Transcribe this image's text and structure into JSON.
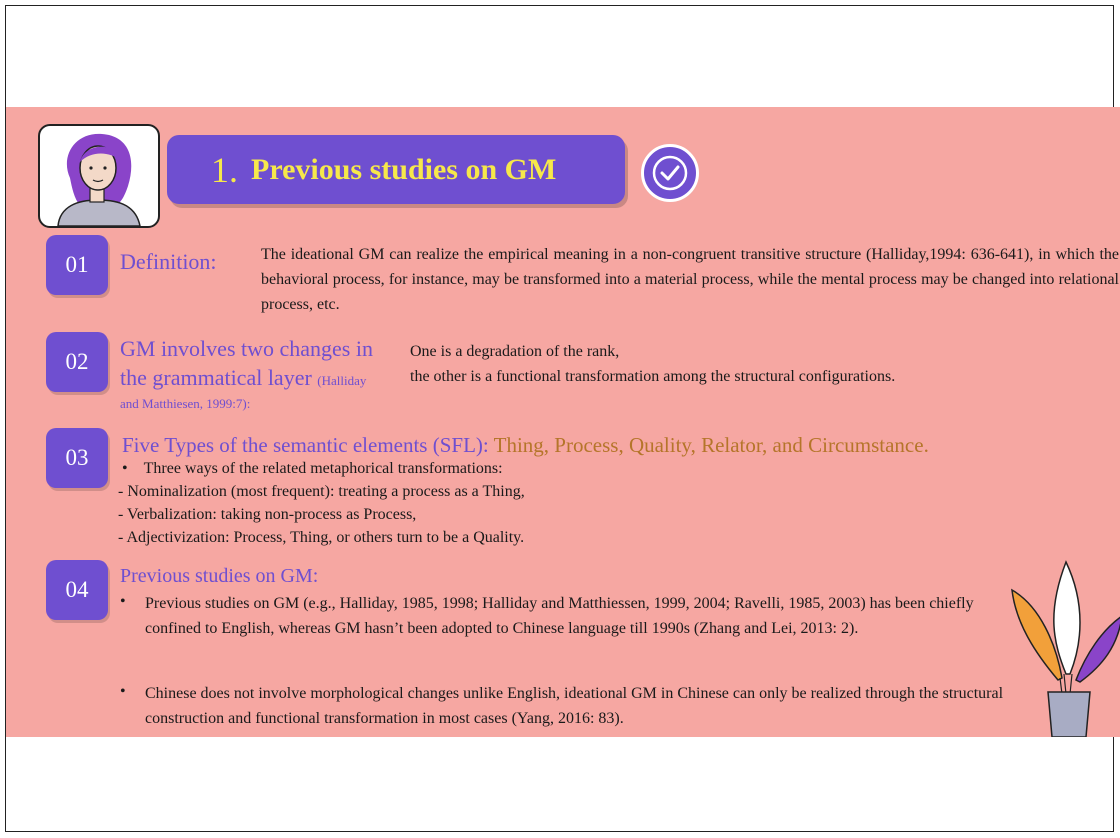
{
  "title": {
    "number": "1.",
    "text": "Previous studies on GM"
  },
  "section1": {
    "num": "01",
    "heading": "Definition:",
    "body": "The ideational GM can realize the empirical meaning in a non-congruent transitive structure (Halliday,1994: 636-641), in which the behavioral process, for instance, may be transformed into a material process, while the mental process may be changed into relational process, etc."
  },
  "section2": {
    "num": "02",
    "heading_line1": "GM involves two changes in",
    "heading_line2": "the grammatical layer",
    "citation_part1": "(Halliday",
    "citation_part2": "and Matthiesen, 1999:7):",
    "body_line1": "One is a degradation of the rank,",
    "body_line2": "the other is a functional transformation among the structural configurations."
  },
  "section3": {
    "num": "03",
    "heading": "Five Types of the semantic elements (SFL):",
    "types": "Thing, Process, Quality, Relator, and Circumstance.",
    "bullet": "Three ways of the related metaphorical transformations:",
    "items": [
      "- Nominalization (most frequent): treating a process as a Thing,",
      "- Verbalization: taking non-process as Process,",
      "- Adjectivization: Process, Thing, or others turn to be a Quality."
    ]
  },
  "section4": {
    "num": "04",
    "heading": "Previous studies on GM:",
    "bullet1": "Previous studies on GM (e.g., Halliday, 1985, 1998; Halliday and Matthiessen, 1999, 2004; Ravelli, 1985, 2003) has been chiefly confined to English, whereas GM hasn’t been adopted to Chinese language till 1990s (Zhang and Lei, 2013: 2).",
    "bullet2": "Chinese does not involve morphological changes unlike English, ideational GM in Chinese can only be realized through the structural construction and functional transformation in most cases (Yang, 2016: 83)."
  },
  "colors": {
    "slide_bg": "#f6a7a2",
    "accent_purple": "#6f4fd0",
    "title_yellow": "#f6e84a",
    "types_orange": "#b5752a"
  },
  "icons": [
    "avatar-illustration",
    "check-icon",
    "plant-illustration"
  ]
}
